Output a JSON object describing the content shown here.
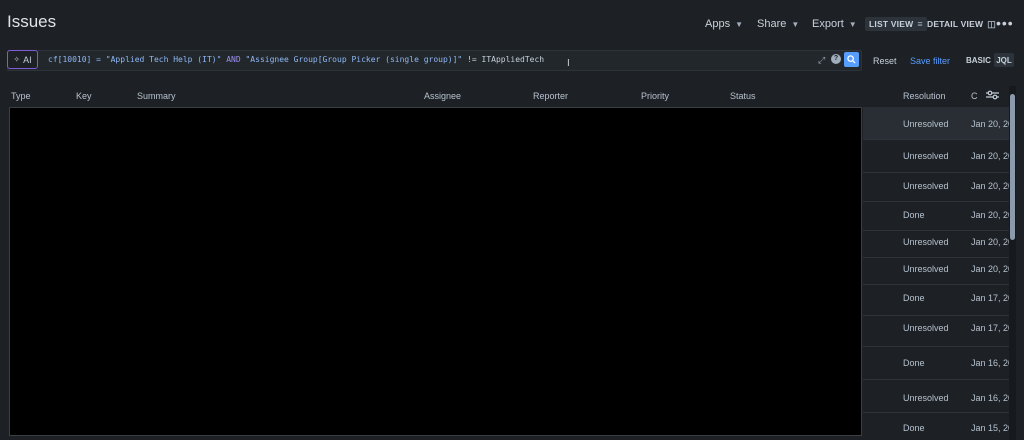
{
  "page_title": "Issues",
  "toolbar": {
    "apps_label": "Apps",
    "share_label": "Share",
    "export_label": "Export",
    "list_view_label": "LIST VIEW",
    "detail_view_label": "DETAIL VIEW",
    "more_label": "•••"
  },
  "search": {
    "ai_label": "AI",
    "jql_part1": "cf[10010] = \"Applied Tech Help (IT)\" ",
    "jql_and": "AND",
    "jql_part2": " \"Assignee Group[Group Picker (single group)]\" ",
    "jql_op": "!=",
    "jql_part3": " ITAppliedTech",
    "help_label": "?",
    "reset_label": "Reset",
    "save_filter_label": "Save filter",
    "basic_label": "BASIC",
    "jql_label": "JQL"
  },
  "columns": [
    "Type",
    "Key",
    "Summary",
    "Assignee",
    "Reporter",
    "Priority",
    "Status",
    "Resolution",
    "C"
  ],
  "rows": [
    {
      "resolution": "Unresolved",
      "date": "Jan 20, 20"
    },
    {
      "resolution": "Unresolved",
      "date": "Jan 20, 20"
    },
    {
      "resolution": "Unresolved",
      "date": "Jan 20, 20"
    },
    {
      "resolution": "Done",
      "date": "Jan 20, 20"
    },
    {
      "resolution": "Unresolved",
      "date": "Jan 20, 20"
    },
    {
      "resolution": "Unresolved",
      "date": "Jan 20, 20"
    },
    {
      "resolution": "Done",
      "date": "Jan 17, 20"
    },
    {
      "resolution": "Unresolved",
      "date": "Jan 17, 20"
    },
    {
      "resolution": "Done",
      "date": "Jan 16, 20"
    },
    {
      "resolution": "Unresolved",
      "date": "Jan 16, 20"
    },
    {
      "resolution": "Done",
      "date": "Jan 15, 20"
    }
  ],
  "colors": {
    "background": "#1d2125",
    "accent": "#579dff",
    "ai_border": "#7f5cd1",
    "redacted": "#000000"
  }
}
